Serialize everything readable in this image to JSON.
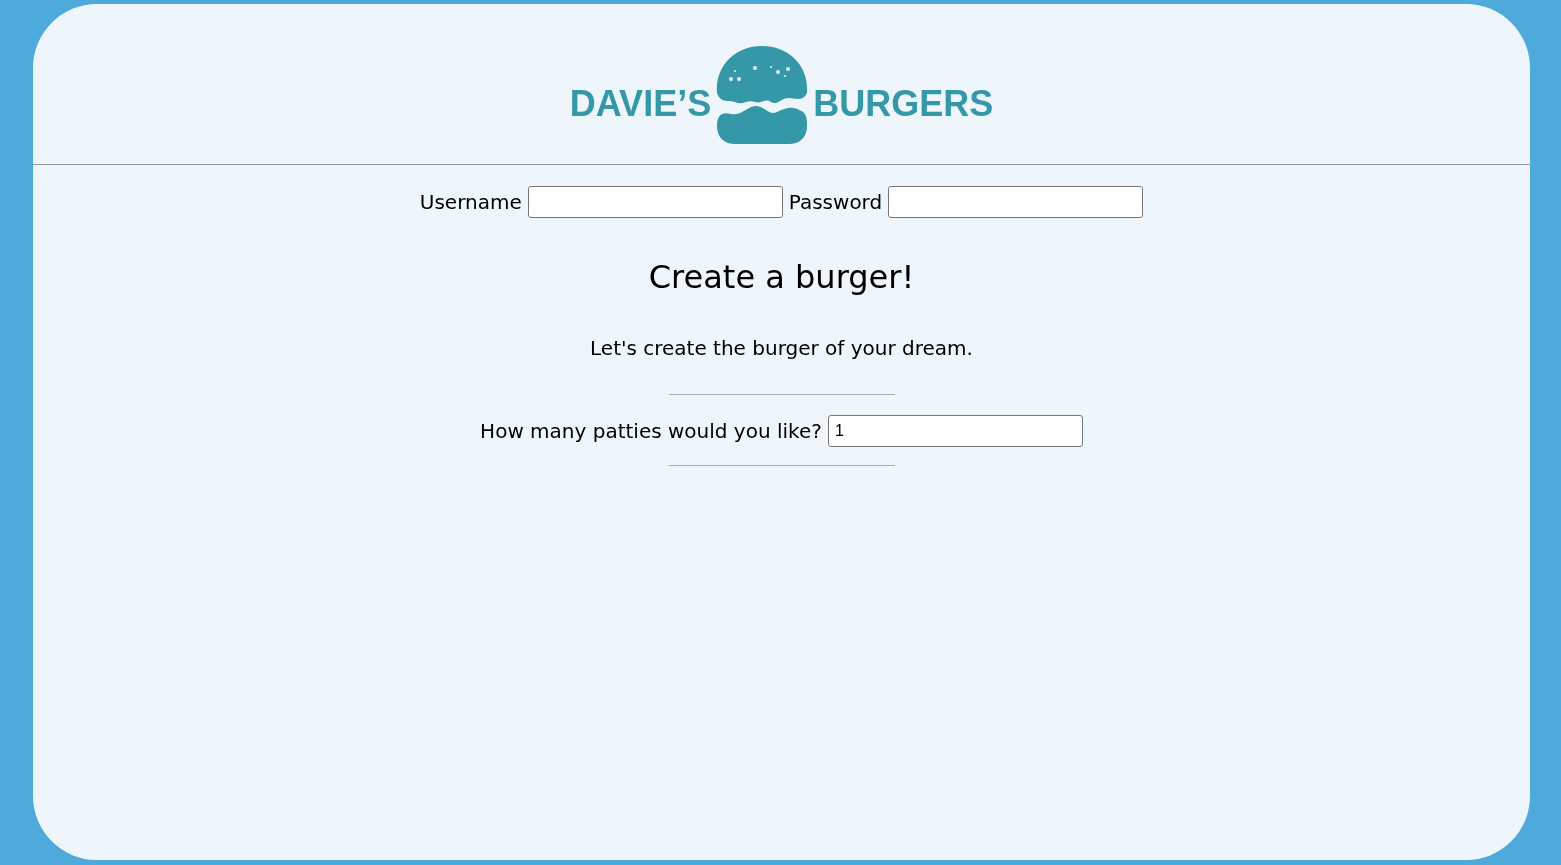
{
  "logo": {
    "left": "DAVIE’S",
    "right": "BURGERS"
  },
  "login": {
    "username_label": "Username",
    "password_label": "Password"
  },
  "title": "Create a burger!",
  "intro": "Let's create the burger of your dream.",
  "patties": {
    "label": "How many patties would you like?",
    "value": "1"
  }
}
